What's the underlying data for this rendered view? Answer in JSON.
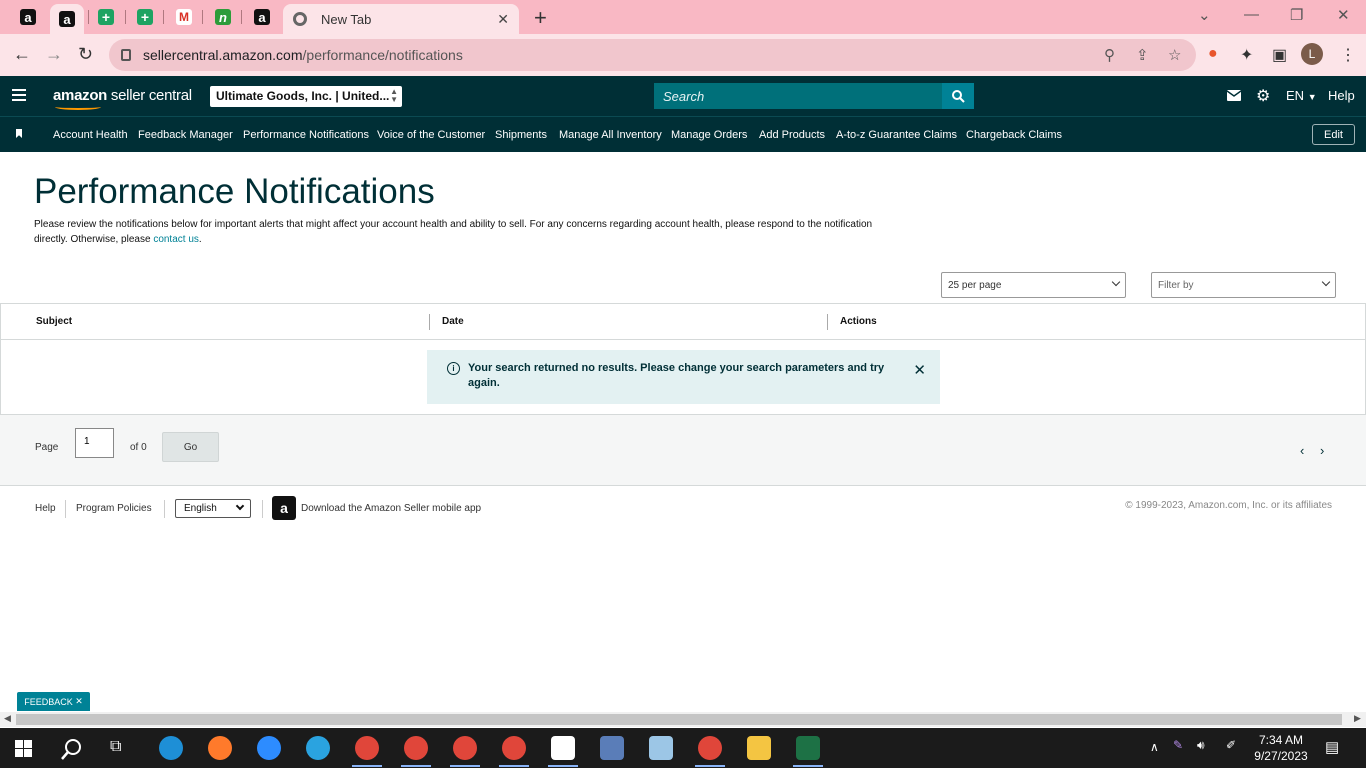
{
  "browser": {
    "pinned_tabs": [
      "a",
      "a",
      "+",
      "+",
      "M",
      "n",
      "a"
    ],
    "active_tab_title": "New Tab",
    "url_host": "sellercentral.amazon.com",
    "url_path": "/performance/notifications",
    "profile_initial": "L"
  },
  "header": {
    "logo_bold": "amazon",
    "logo_rest": " seller central",
    "account_selector": "Ultimate Goods, Inc. | United...",
    "search_placeholder": "Search",
    "language": "EN",
    "help": "Help"
  },
  "nav": {
    "items": [
      "Account Health",
      "Feedback Manager",
      "Performance Notifications",
      "Voice of the Customer",
      "Shipments",
      "Manage All Inventory",
      "Manage Orders",
      "Add Products",
      "A-to-z Guarantee Claims",
      "Chargeback Claims"
    ],
    "edit": "Edit"
  },
  "page": {
    "title": "Performance Notifications",
    "description": "Please review the notifications below for important alerts that might affect your account health and ability to sell. For any concerns regarding account health, please respond to the notification directly. Otherwise, please ",
    "contact_link": "contact us",
    "description_end": ".",
    "per_page": "25 per page",
    "filter_placeholder": "Filter by"
  },
  "table": {
    "columns": [
      "Subject",
      "Date",
      "Actions"
    ],
    "alert_message": "Your search returned no results. Please change your search parameters and try again."
  },
  "pager": {
    "page_label": "Page",
    "page_value": "1",
    "of_label": "of 0",
    "go": "Go"
  },
  "footer": {
    "help": "Help",
    "program_policies": "Program Policies",
    "language": "English",
    "app_text": "Download the Amazon Seller mobile app",
    "copyright": "© 1999-2023, Amazon.com, Inc. or its affiliates"
  },
  "feedback": "FEEDBACK",
  "taskbar": {
    "time": "7:34 AM",
    "date": "9/27/2023"
  },
  "colors": {
    "header_bg": "#002f36",
    "accent": "#008296",
    "tab_strip": "#f9b8c4",
    "alert_bg": "#e3f1f2"
  }
}
